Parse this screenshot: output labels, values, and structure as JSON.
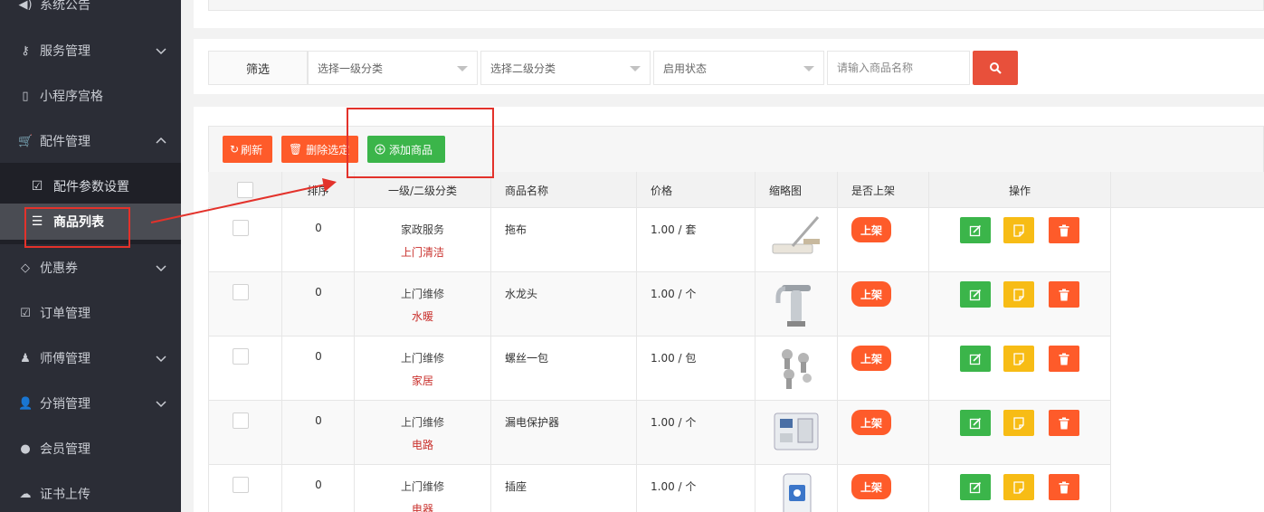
{
  "sidebar": {
    "items": [
      {
        "label": "系统公告",
        "icon": "speaker-icon"
      },
      {
        "label": "服务管理",
        "icon": "key-icon",
        "expandable": true
      },
      {
        "label": "小程序宫格",
        "icon": "phone-icon"
      },
      {
        "label": "配件管理",
        "icon": "cart-icon",
        "expanded": true
      },
      {
        "label": "优惠券",
        "icon": "diamond-icon",
        "expandable": true
      },
      {
        "label": "订单管理",
        "icon": "checkbox-icon"
      },
      {
        "label": "师傅管理",
        "icon": "worker-icon",
        "expandable": true
      },
      {
        "label": "分销管理",
        "icon": "user-plus-icon",
        "expandable": true
      },
      {
        "label": "会员管理",
        "icon": "user-icon"
      },
      {
        "label": "证书上传",
        "icon": "cloud-upload-icon"
      }
    ],
    "sub_items": [
      {
        "label": "配件参数设置",
        "icon": "check-square-icon"
      },
      {
        "label": "商品列表",
        "icon": "sliders-icon",
        "active": true
      }
    ]
  },
  "filter": {
    "label": "筛选",
    "category1_placeholder": "选择一级分类",
    "category2_placeholder": "选择二级分类",
    "status_placeholder": "启用状态",
    "name_placeholder": "请输入商品名称"
  },
  "toolbar": {
    "refresh_label": "刷新",
    "delete_label": "删除选定",
    "add_label": "添加商品"
  },
  "table": {
    "headers": {
      "sort": "排序",
      "category": "一级/二级分类",
      "name": "商品名称",
      "price": "价格",
      "thumb": "缩略图",
      "on_shelf": "是否上架",
      "actions": "操作"
    },
    "rows": [
      {
        "sort": "0",
        "cat1": "家政服务",
        "cat2": "上门清洁",
        "name": "拖布",
        "price": "1.00 / 套",
        "thumb": "mop",
        "status": "上架"
      },
      {
        "sort": "0",
        "cat1": "上门维修",
        "cat2": "水暖",
        "name": "水龙头",
        "price": "1.00 / 个",
        "thumb": "faucet",
        "status": "上架"
      },
      {
        "sort": "0",
        "cat1": "上门维修",
        "cat2": "家居",
        "name": "螺丝一包",
        "price": "1.00 / 包",
        "thumb": "screws",
        "status": "上架"
      },
      {
        "sort": "0",
        "cat1": "上门维修",
        "cat2": "电路",
        "name": "漏电保护器",
        "price": "1.00 / 个",
        "thumb": "breaker",
        "status": "上架"
      },
      {
        "sort": "0",
        "cat1": "上门维修",
        "cat2": "电器",
        "name": "插座",
        "price": "1.00 / 个",
        "thumb": "socket",
        "status": "上架"
      }
    ]
  },
  "colors": {
    "sidebar_bg": "#2b2d36",
    "accent_orange": "#fe5b2a",
    "accent_green": "#3bb54a",
    "accent_yellow": "#f7bc15",
    "search_red": "#e8503b",
    "annotation_red": "#e3322b"
  }
}
